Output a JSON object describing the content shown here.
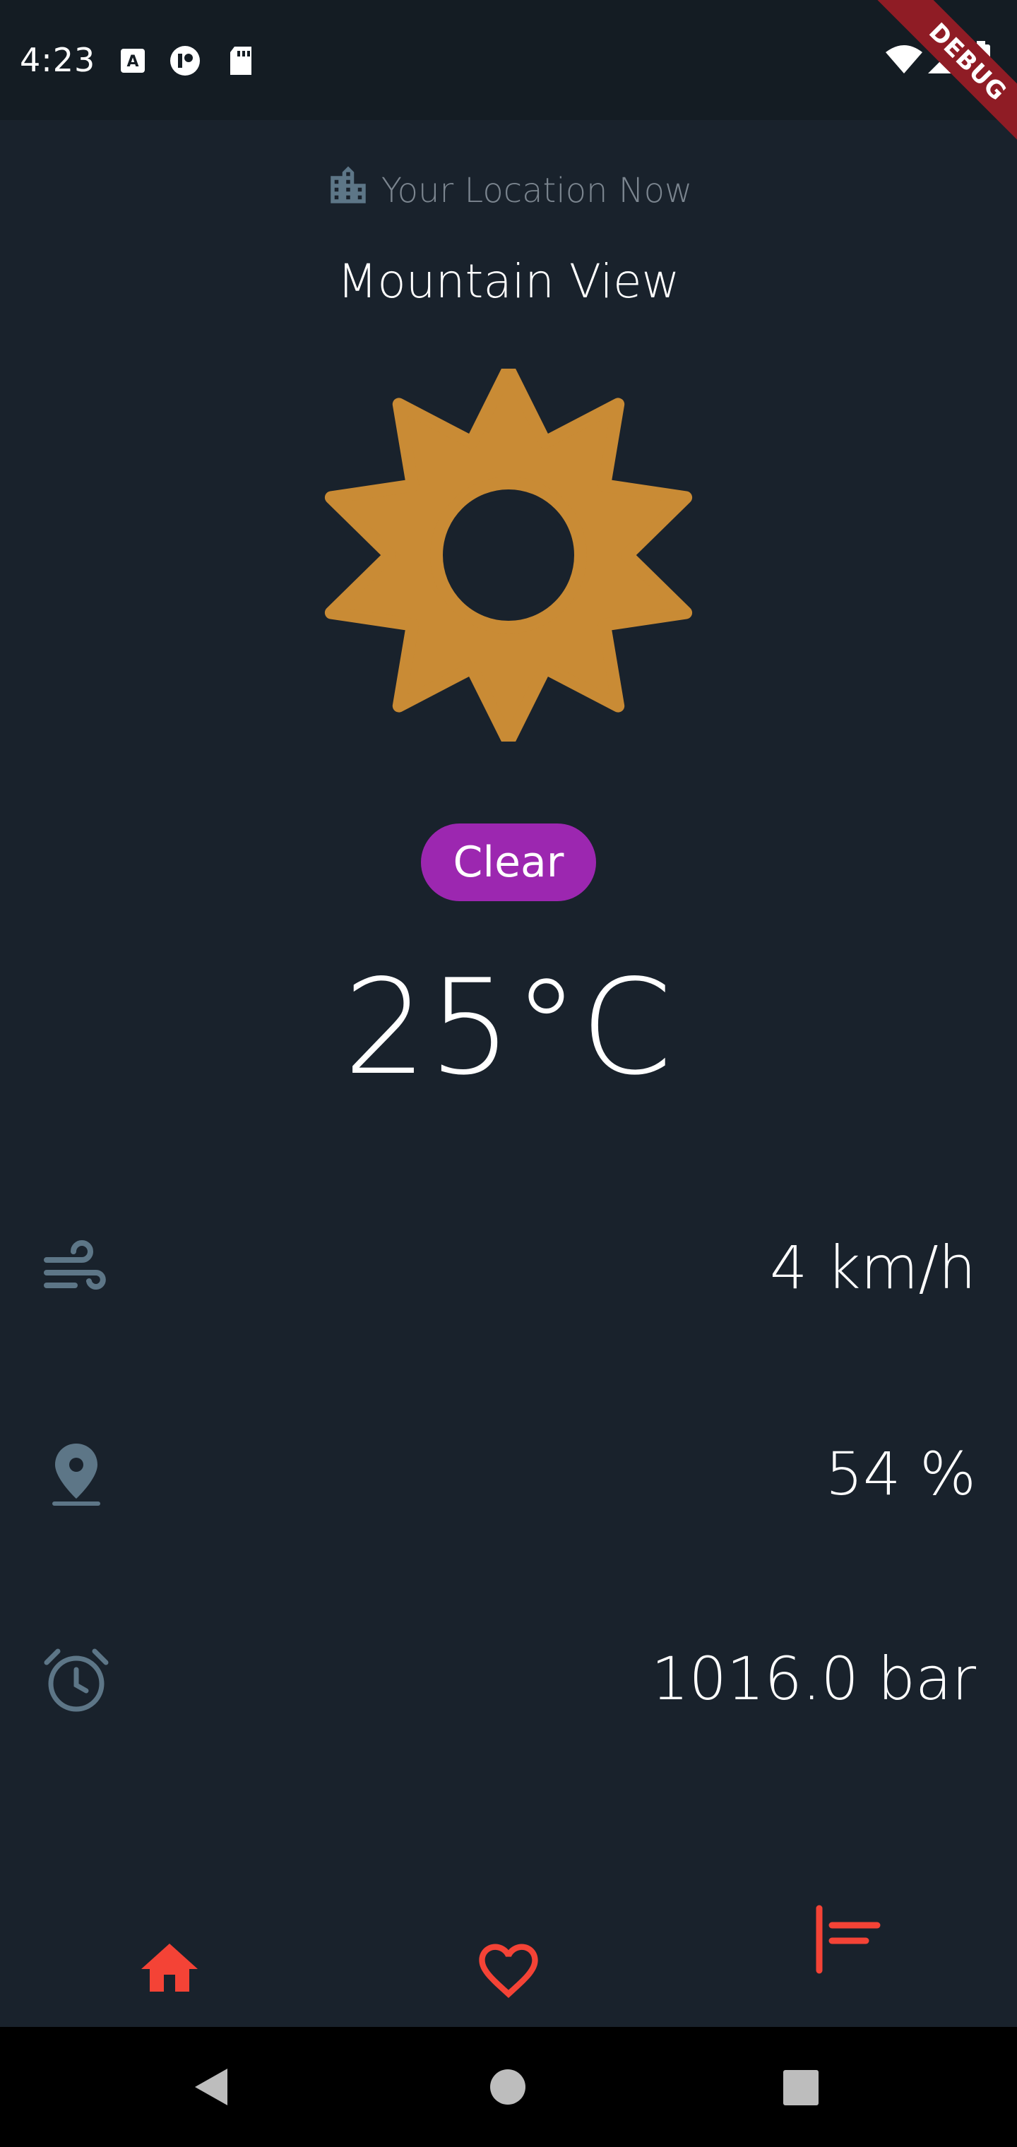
{
  "status_bar": {
    "time": "4:23",
    "debug_label": "DEBUG"
  },
  "header": {
    "location_label": "Your Location Now",
    "city": "Mountain View"
  },
  "weather": {
    "condition": "Clear",
    "temperature": "25°C",
    "icon": "sun-icon",
    "icon_color": "#c98b35",
    "badge_color": "#9c27b0"
  },
  "metrics": [
    {
      "icon": "wind-icon",
      "value": "4 km/h"
    },
    {
      "icon": "location-pin-icon",
      "value": "54 %"
    },
    {
      "icon": "alarm-clock-icon",
      "value": "1016.0 bar"
    }
  ],
  "bottom_nav": {
    "items": [
      "home-icon",
      "heart-icon",
      "list-icon"
    ],
    "accent_color": "#f44336"
  },
  "system_nav": [
    "back-icon",
    "home-circle-icon",
    "recents-icon"
  ]
}
